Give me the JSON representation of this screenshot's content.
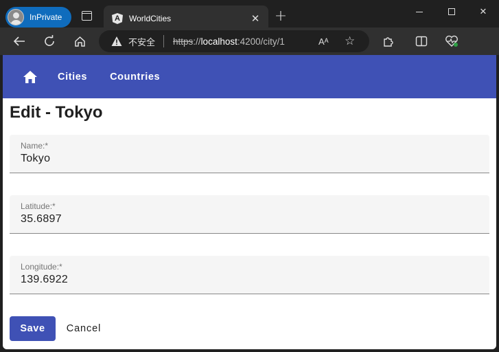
{
  "browser": {
    "profile_label": "InPrivate",
    "tab_title": "WorldCities",
    "security_label": "不安全",
    "url_protocol": "https",
    "url_sep": "://",
    "url_host": "localhost",
    "url_rest": ":4200/city/1",
    "read_aloud_label": "Aᴬ"
  },
  "appbar": {
    "nav_cities": "Cities",
    "nav_countries": "Countries",
    "color": "#3f51b5"
  },
  "page": {
    "title": "Edit - Tokyo"
  },
  "form": {
    "name": {
      "label": "Name:*",
      "value": "Tokyo"
    },
    "latitude": {
      "label": "Latitude:*",
      "value": "35.6897"
    },
    "longitude": {
      "label": "Longitude:*",
      "value": "139.6922"
    },
    "save_label": "Save",
    "cancel_label": "Cancel"
  }
}
